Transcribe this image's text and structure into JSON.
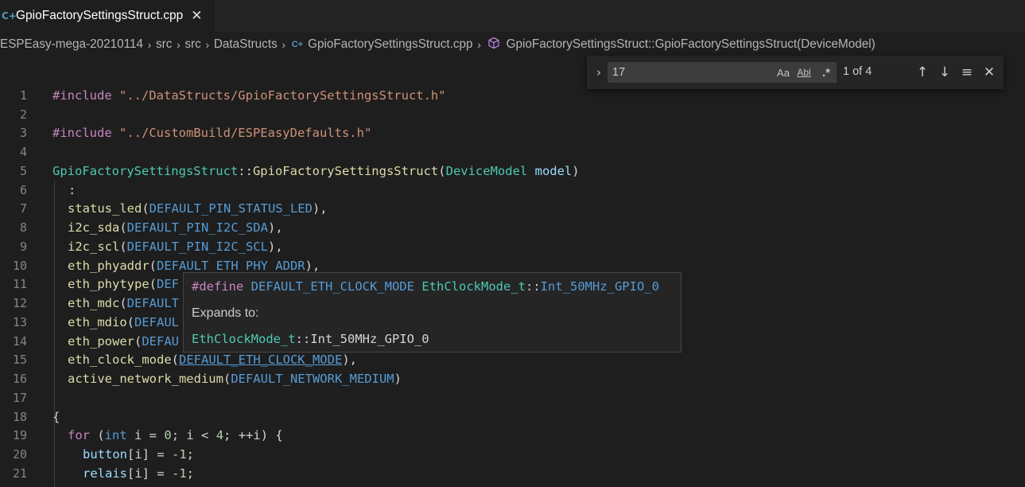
{
  "tab": {
    "icon": "cpp-file-icon",
    "icon_glyph": "C+",
    "label": "GpioFactorySettingsStruct.cpp",
    "close_glyph": "✕"
  },
  "breadcrumb": {
    "items": [
      "ESPEasy-mega-20210114",
      "src",
      "src",
      "DataStructs"
    ],
    "file": "GpioFactorySettingsStruct.cpp",
    "symbol": "GpioFactorySettingsStruct::GpioFactorySettingsStruct(DeviceModel)",
    "separator": "›"
  },
  "find": {
    "query": "17",
    "toggle_glyph": "›",
    "match_case": "Aa",
    "whole_word": "Abl",
    "regex": ".*",
    "count": "1 of 4",
    "prev_glyph": "↑",
    "next_glyph": "↓",
    "selection_glyph": "≡",
    "close_glyph": "✕"
  },
  "line_numbers": [
    "1",
    "2",
    "3",
    "4",
    "5",
    "6",
    "7",
    "8",
    "9",
    "10",
    "11",
    "12",
    "13",
    "14",
    "15",
    "16",
    "17",
    "18",
    "19",
    "20",
    "21"
  ],
  "code": {
    "l1": {
      "pre": "#include",
      "str": "\"../DataStructs/GpioFactorySettingsStruct.h\""
    },
    "l3": {
      "pre": "#include",
      "str": "\"../CustomBuild/ESPEasyDefaults.h\""
    },
    "l5": {
      "cls": "GpioFactorySettingsStruct",
      "sep": "::",
      "ctor": "GpioFactorySettingsStruct",
      "open": "(",
      "ptype": "DeviceModel",
      "pname": "model",
      "close": ")"
    },
    "l6": ":",
    "members": [
      {
        "name": "status_led",
        "macro": "DEFAULT_PIN_STATUS_LED",
        "tail": "),"
      },
      {
        "name": "i2c_sda",
        "macro": "DEFAULT_PIN_I2C_SDA",
        "tail": "),"
      },
      {
        "name": "i2c_scl",
        "macro": "DEFAULT_PIN_I2C_SCL",
        "tail": "),"
      },
      {
        "name": "eth_phyaddr",
        "macro": "DEFAULT_ETH_PHY_ADDR",
        "tail": "),"
      },
      {
        "name": "eth_phytype",
        "macro": "DEF",
        "tail": ""
      },
      {
        "name": "eth_mdc",
        "macro": "DEFAULT",
        "tail": ""
      },
      {
        "name": "eth_mdio",
        "macro": "DEFAUL",
        "tail": ""
      },
      {
        "name": "eth_power",
        "macro": "DEFAU",
        "tail": ""
      },
      {
        "name": "eth_clock_mode",
        "macro": "DEFAULT_ETH_CLOCK_MODE",
        "tail": "),"
      },
      {
        "name": "active_network_medium",
        "macro": "DEFAULT_NETWORK_MEDIUM",
        "tail": ")"
      }
    ],
    "l18": "{",
    "l19": {
      "for": "for",
      "open": " (",
      "int": "int",
      "a": " i = ",
      "zero": "0",
      "b": "; i < ",
      "four": "4",
      "c": "; ++i) {"
    },
    "l20": {
      "name": "button",
      "idx": "[i] = ",
      "val": "-1",
      "semi": ";"
    },
    "l21": {
      "name": "relais",
      "idx": "[i] = ",
      "val": "-1",
      "semi": ";"
    }
  },
  "hover": {
    "define": "#define",
    "macro": "DEFAULT_ETH_CLOCK_MODE",
    "type": "EthClockMode_t",
    "sep": "::",
    "value": "Int_50MHz_GPIO_0",
    "expands_label": "Expands to:"
  },
  "colors": {
    "background": "#1e1e1e",
    "keyword_preprocessor": "#c586c0",
    "string": "#ce9178",
    "type": "#4ec9b0",
    "function": "#dcdcaa",
    "variable": "#9cdcfe",
    "macro": "#569cd6",
    "number": "#b5cea8"
  }
}
